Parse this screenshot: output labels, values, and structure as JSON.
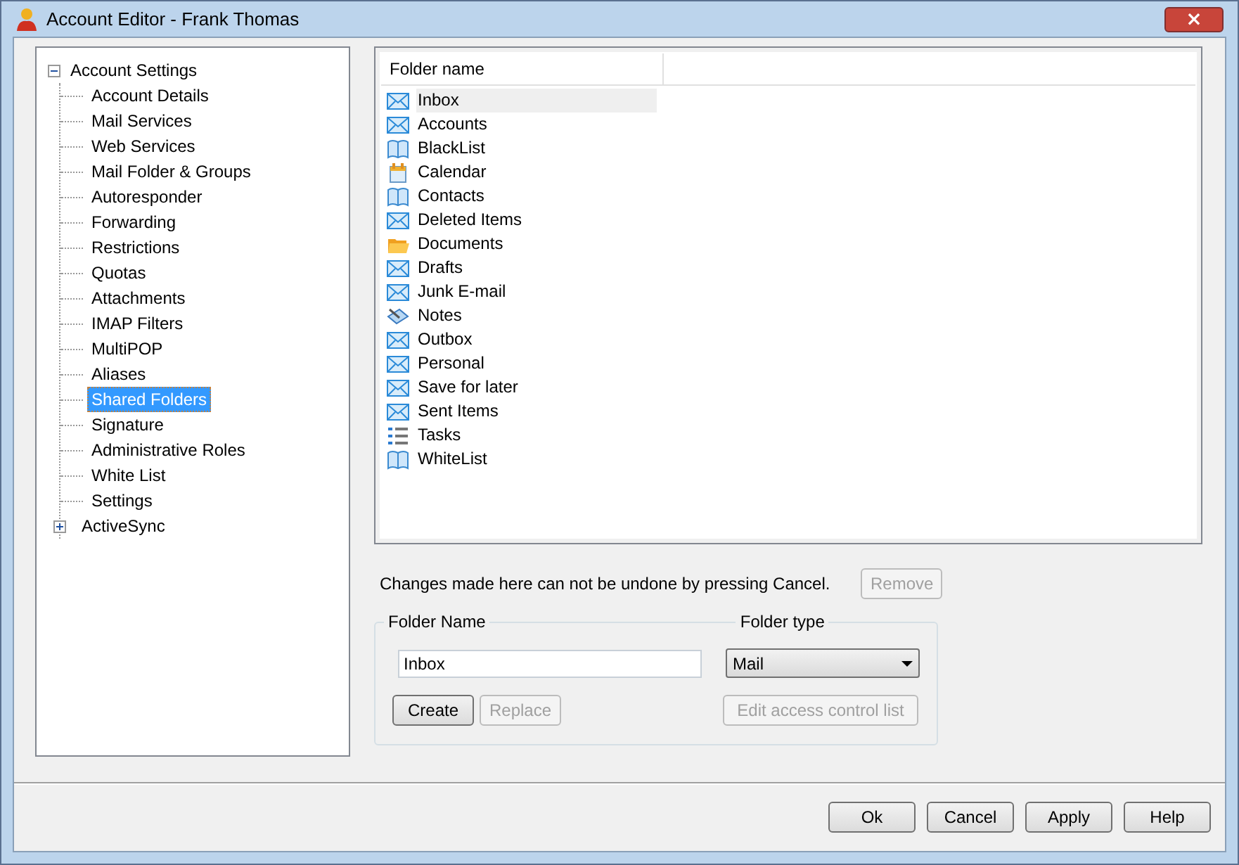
{
  "window": {
    "title": "Account Editor - Frank Thomas",
    "close_label": "×"
  },
  "tree": [
    {
      "label": "Account Settings",
      "selected": false,
      "expanded": true,
      "children": [
        {
          "label": "Account Details",
          "selected": false
        },
        {
          "label": "Mail Services",
          "selected": false
        },
        {
          "label": "Web Services",
          "selected": false
        },
        {
          "label": "Mail Folder & Groups",
          "selected": false
        },
        {
          "label": "Autoresponder",
          "selected": false
        },
        {
          "label": "Forwarding",
          "selected": false
        },
        {
          "label": "Restrictions",
          "selected": false
        },
        {
          "label": "Quotas",
          "selected": false
        },
        {
          "label": "Attachments",
          "selected": false
        },
        {
          "label": "IMAP Filters",
          "selected": false
        },
        {
          "label": "MultiPOP",
          "selected": false
        },
        {
          "label": "Aliases",
          "selected": false
        },
        {
          "label": "Shared Folders",
          "selected": true
        },
        {
          "label": "Signature",
          "selected": false
        },
        {
          "label": "Administrative Roles",
          "selected": false
        },
        {
          "label": "White List",
          "selected": false
        },
        {
          "label": "Settings",
          "selected": false
        },
        {
          "label": "ActiveSync",
          "selected": false,
          "expanded": false
        }
      ]
    }
  ],
  "folder_list": {
    "columns": [
      "Folder name"
    ],
    "rows": [
      {
        "name": "Inbox",
        "kind": "mail",
        "selected": true
      },
      {
        "name": "Accounts",
        "kind": "mail",
        "selected": false
      },
      {
        "name": "BlackList",
        "kind": "book",
        "selected": false
      },
      {
        "name": "Calendar",
        "kind": "calendar",
        "selected": false
      },
      {
        "name": "Contacts",
        "kind": "book",
        "selected": false
      },
      {
        "name": "Deleted Items",
        "kind": "mail",
        "selected": false
      },
      {
        "name": "Documents",
        "kind": "folder",
        "selected": false
      },
      {
        "name": "Drafts",
        "kind": "mail",
        "selected": false
      },
      {
        "name": "Junk E-mail",
        "kind": "mail",
        "selected": false
      },
      {
        "name": "Notes",
        "kind": "notes",
        "selected": false
      },
      {
        "name": "Outbox",
        "kind": "mail",
        "selected": false
      },
      {
        "name": "Personal",
        "kind": "mail",
        "selected": false
      },
      {
        "name": "Save for later",
        "kind": "mail",
        "selected": false
      },
      {
        "name": "Sent Items",
        "kind": "mail",
        "selected": false
      },
      {
        "name": "Tasks",
        "kind": "tasks",
        "selected": false
      },
      {
        "name": "WhiteList",
        "kind": "book",
        "selected": false
      }
    ]
  },
  "warning": "Changes made here can not be undone by pressing Cancel.",
  "remove_button": {
    "label": "Remove",
    "disabled": true
  },
  "folder_group": {
    "name_label": "Folder Name",
    "name_value": "Inbox",
    "type_label": "Folder type",
    "type_value": "Mail",
    "buttons": [
      {
        "label": "Create",
        "disabled": false
      },
      {
        "label": "Replace",
        "disabled": true
      }
    ],
    "acl_button": {
      "label": "Edit access control list",
      "disabled": true
    }
  },
  "footer_buttons": [
    {
      "label": "Ok",
      "disabled": false
    },
    {
      "label": "Cancel",
      "disabled": false
    },
    {
      "label": "Apply",
      "disabled": false
    },
    {
      "label": "Help",
      "disabled": false
    }
  ]
}
